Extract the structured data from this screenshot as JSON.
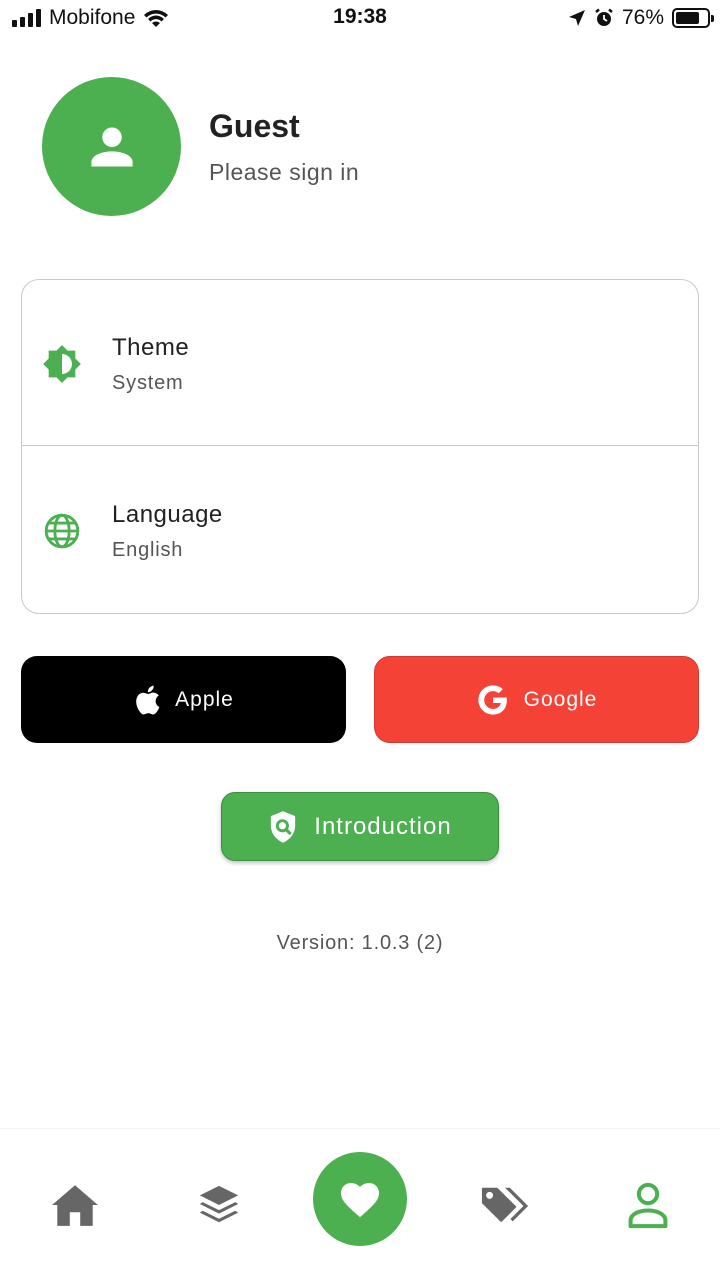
{
  "status_bar": {
    "carrier": "Mobifone",
    "time": "19:38",
    "battery": "76%",
    "battery_level": 0.76
  },
  "profile": {
    "name": "Guest",
    "subtitle": "Please sign in",
    "avatar_icon": "person-icon"
  },
  "settings": [
    {
      "title": "Theme",
      "value": "System",
      "icon": "brightness-icon"
    },
    {
      "title": "Language",
      "value": "English",
      "icon": "globe-icon"
    }
  ],
  "buttons": {
    "apple": "Apple",
    "google": "Google",
    "introduction": "Introduction"
  },
  "version": "Version: 1.0.3 (2)",
  "bottom_nav": [
    {
      "icon": "home-icon",
      "active": false
    },
    {
      "icon": "layers-icon",
      "active": false
    },
    {
      "icon": "heart-icon",
      "active": false
    },
    {
      "icon": "tags-icon",
      "active": false
    },
    {
      "icon": "person-icon",
      "active": true
    }
  ],
  "colors": {
    "accent": "#4caf50",
    "google": "#f44336",
    "apple": "#000000",
    "nav_inactive": "#666666"
  }
}
